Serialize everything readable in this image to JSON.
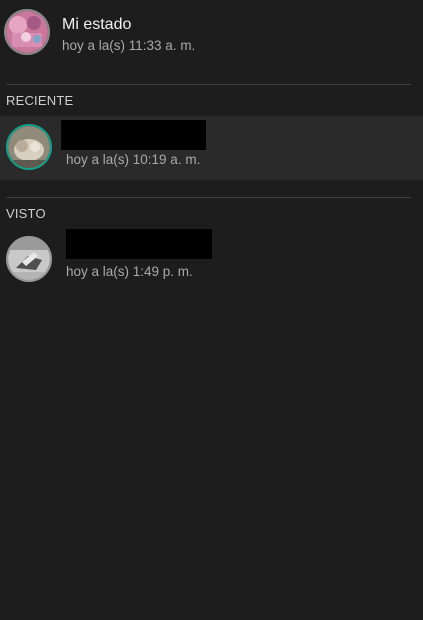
{
  "my_status": {
    "title": "Mi estado",
    "time": "hoy a la(s) 11:33 a. m."
  },
  "sections": {
    "recent_label": "RECIENTE",
    "seen_label": "VISTO"
  },
  "recent": [
    {
      "name": "",
      "time": "hoy a la(s) 10:19 a. m."
    }
  ],
  "seen": [
    {
      "name": "",
      "time": "hoy a la(s) 1:49 p. m."
    }
  ],
  "colors": {
    "background": "#1d1d1d",
    "highlight_row": "#2a2a2a",
    "unseen_ring": "#12a18a",
    "seen_ring": "#9a9a9a"
  }
}
